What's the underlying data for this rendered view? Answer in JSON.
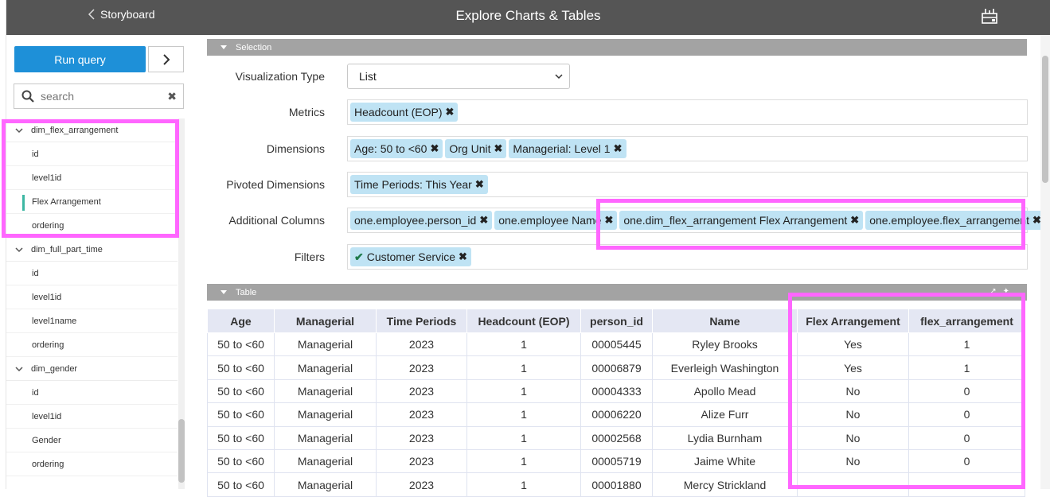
{
  "header": {
    "back_label": "Storyboard",
    "title": "Explore Charts & Tables"
  },
  "sidebar": {
    "run_query": "Run query",
    "search_placeholder": "search",
    "groups": [
      {
        "name": "dim_flex_arrangement",
        "items": [
          "id",
          "level1id",
          "Flex Arrangement",
          "ordering"
        ]
      },
      {
        "name": "dim_full_part_time",
        "items": [
          "id",
          "level1id",
          "level1name",
          "ordering"
        ]
      },
      {
        "name": "dim_gender",
        "items": [
          "id",
          "level1id",
          "Gender",
          "ordering"
        ]
      }
    ]
  },
  "selection": {
    "section_title": "Selection",
    "viz_label": "Visualization Type",
    "viz_value": "List",
    "metrics_label": "Metrics",
    "metrics": [
      "Headcount (EOP)"
    ],
    "dimensions_label": "Dimensions",
    "dimensions": [
      "Age: 50 to <60",
      "Org Unit",
      "Managerial: Level 1"
    ],
    "pivoted_label": "Pivoted Dimensions",
    "pivoted": [
      "Time Periods: This Year"
    ],
    "additional_label": "Additional Columns",
    "additional": [
      "one.employee.person_id",
      "one.employee Name",
      "one.dim_flex_arrangement Flex Arrangement",
      "one.employee.flex_arrangement"
    ],
    "filters_label": "Filters",
    "filters": [
      "Customer Service"
    ]
  },
  "table": {
    "section_title": "Table",
    "columns": [
      "Age",
      "Managerial",
      "Time Periods",
      "Headcount (EOP)",
      "person_id",
      "Name",
      "Flex Arrangement",
      "flex_arrangement"
    ],
    "rows": [
      [
        "50 to <60",
        "Managerial",
        "2023",
        "1",
        "00005445",
        "Ryley Brooks",
        "Yes",
        "1"
      ],
      [
        "50 to <60",
        "Managerial",
        "2023",
        "1",
        "00006879",
        "Everleigh Washington",
        "Yes",
        "1"
      ],
      [
        "50 to <60",
        "Managerial",
        "2023",
        "1",
        "00004333",
        "Apollo Mead",
        "No",
        "0"
      ],
      [
        "50 to <60",
        "Managerial",
        "2023",
        "1",
        "00006220",
        "Alize Furr",
        "No",
        "0"
      ],
      [
        "50 to <60",
        "Managerial",
        "2023",
        "1",
        "00002568",
        "Lydia Burnham",
        "No",
        "0"
      ],
      [
        "50 to <60",
        "Managerial",
        "2023",
        "1",
        "00005719",
        "Jaime White",
        "No",
        "0"
      ],
      [
        "50 to <60",
        "Managerial",
        "2023",
        "1",
        "00001880",
        "Mercy Strickland",
        "",
        ""
      ]
    ]
  }
}
